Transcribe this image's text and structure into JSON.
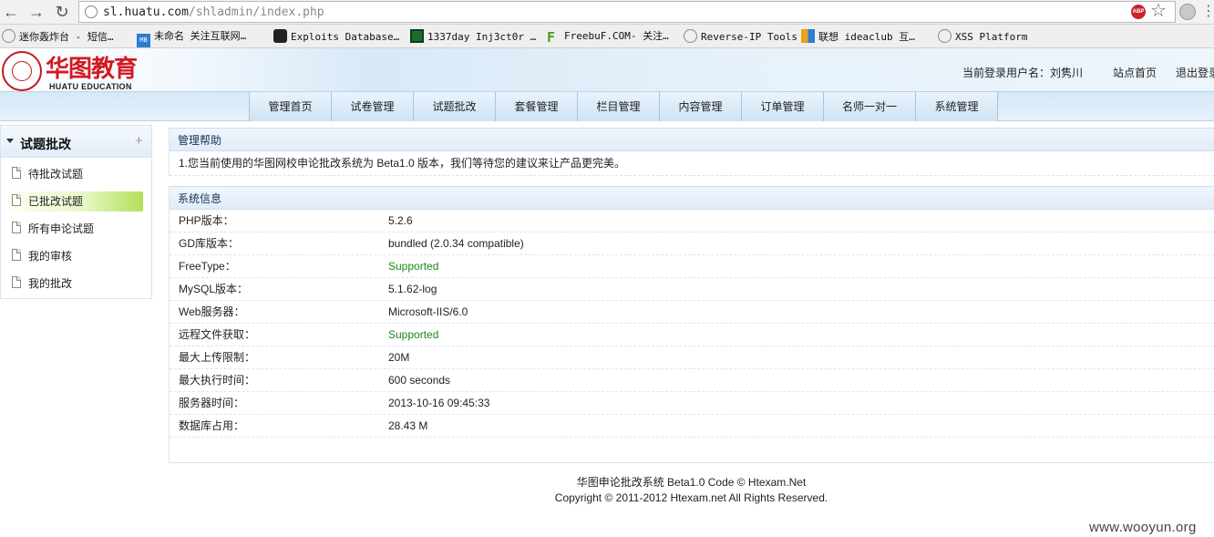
{
  "browser": {
    "url_host": "sl.huatu.com",
    "url_path": "/shladmin/index.php",
    "abp_label": "ABP",
    "bookmarks": [
      {
        "label": "迷你轰炸台 - 短信…",
        "icon": "globe-icon",
        "color": "#7a7a7a"
      },
      {
        "label": "未命名 关注互联网…",
        "icon": "mb-icon",
        "color": "#2a7fd4"
      },
      {
        "label": "Exploits Database…",
        "icon": "exploit-db-icon",
        "color": "#222222"
      },
      {
        "label": "1337day Inj3ct0r …",
        "icon": "chip-icon",
        "color": "#1f6b2e"
      },
      {
        "label": "FreebuF.COM- 关注…",
        "icon": "freebuf-icon",
        "color": "#4a9b1a"
      },
      {
        "label": "Reverse-IP Tools",
        "icon": "globe-icon",
        "color": "#7a7a7a"
      },
      {
        "label": "联想 ideaclub 互…",
        "icon": "windows-icon",
        "color": "#e8a317"
      },
      {
        "label": "XSS Platform",
        "icon": "globe-icon",
        "color": "#7a7a7a"
      }
    ]
  },
  "header": {
    "logo_cn": "华图教育",
    "logo_en": "HUATU EDUCATION",
    "user_label": "当前登录用户名：刘隽川",
    "site_home": "站点首页",
    "logout": "退出登录"
  },
  "menu": [
    "管理首页",
    "试卷管理",
    "试题批改",
    "套餐管理",
    "栏目管理",
    "内容管理",
    "订单管理",
    "名师一对一",
    "系统管理"
  ],
  "sidebar": {
    "title": "试题批改",
    "items": [
      "待批改试题",
      "已批改试题",
      "所有申论试题",
      "我的审核",
      "我的批改"
    ],
    "active_index": 1
  },
  "help": {
    "title": "管理帮助",
    "text": "1.您当前使用的华图网校申论批改系统为 Beta1.0 版本，我们等待您的建议来让产品更完美。"
  },
  "sysinfo": {
    "title": "系统信息",
    "rows": [
      {
        "key": "PHP版本：",
        "value": "5.2.6",
        "status": "normal"
      },
      {
        "key": "GD库版本：",
        "value": "bundled (2.0.34 compatible)",
        "status": "normal"
      },
      {
        "key": "FreeType：",
        "value": "Supported",
        "status": "ok"
      },
      {
        "key": "MySQL版本：",
        "value": "5.1.62-log",
        "status": "normal"
      },
      {
        "key": "Web服务器：",
        "value": "Microsoft-IIS/6.0",
        "status": "normal"
      },
      {
        "key": "远程文件获取：",
        "value": "Supported",
        "status": "ok"
      },
      {
        "key": "最大上传限制：",
        "value": "20M",
        "status": "normal"
      },
      {
        "key": "最大执行时间：",
        "value": "600 seconds",
        "status": "normal"
      },
      {
        "key": "服务器时间：",
        "value": "2013-10-16 09:45:33",
        "status": "normal"
      },
      {
        "key": "数据库占用：",
        "value": "28.43 M",
        "status": "normal"
      }
    ]
  },
  "footer": {
    "line1": "华图申论批改系统 Beta1.0 Code © Htexam.Net",
    "line2": "Copyright © 2011-2012 Htexam.net All Rights Reserved."
  },
  "watermark": "www.wooyun.org",
  "colors": {
    "accent": "#1b8a1b",
    "brand": "#d11a22"
  }
}
